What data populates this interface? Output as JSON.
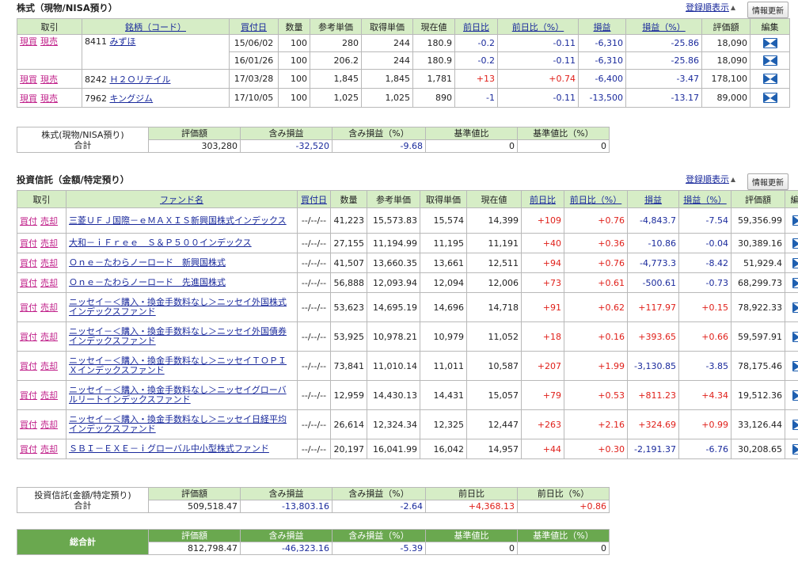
{
  "stocks": {
    "title": "株式（現物/NISA預り）",
    "sort_link": "登録順表示",
    "update_button": "情報更新",
    "headers": [
      "取引",
      "銘柄（コード）",
      "買付日",
      "数量",
      "参考単価",
      "取得単価",
      "現在値",
      "前日比",
      "前日比（%）",
      "損益",
      "損益（%）",
      "評価額",
      "編集"
    ],
    "buy_label": "現買",
    "sell_label": "現売",
    "rows": [
      {
        "code": "8411",
        "name": "みずほ",
        "date": "15/06/02",
        "qty": "100",
        "ref": "280",
        "cost": "244",
        "price": "180.9",
        "chg": "-0.2",
        "chgp": "-0.11",
        "pl": "-6,310",
        "plp": "-25.86",
        "val": "18,090"
      },
      {
        "date": "16/01/26",
        "qty": "100",
        "ref": "206.2",
        "cost": "244",
        "price": "180.9",
        "chg": "-0.2",
        "chgp": "-0.11",
        "pl": "-6,310",
        "plp": "-25.86",
        "val": "18,090"
      },
      {
        "code": "8242",
        "name": "Ｈ２Ｏリテイル",
        "date": "17/03/28",
        "qty": "100",
        "ref": "1,845",
        "cost": "1,845",
        "price": "1,781",
        "chg": "+13",
        "chgp": "+0.74",
        "pl": "-6,400",
        "plp": "-3.47",
        "val": "178,100"
      },
      {
        "code": "7962",
        "name": "キングジム",
        "date": "17/10/05",
        "qty": "100",
        "ref": "1,025",
        "cost": "1,025",
        "price": "890",
        "chg": "-1",
        "chgp": "-0.11",
        "pl": "-13,500",
        "plp": "-13.17",
        "val": "89,000"
      }
    ],
    "summary": {
      "label1": "株式(現物/NISA預り)",
      "label2": "合計",
      "headers": [
        "評価額",
        "含み損益",
        "含み損益（%）",
        "基準値比",
        "基準値比（%）"
      ],
      "values": [
        "303,280",
        "-32,520",
        "-9.68",
        "0",
        "0"
      ]
    }
  },
  "funds": {
    "title": "投資信託（金額/特定預り）",
    "sort_link": "登録順表示",
    "update_button": "情報更新",
    "headers": [
      "取引",
      "ファンド名",
      "買付日",
      "数量",
      "参考単価",
      "取得単価",
      "現在値",
      "前日比",
      "前日比（%）",
      "損益",
      "損益（%）",
      "評価額",
      "編集"
    ],
    "buy_label": "買付",
    "sell_label": "売却",
    "rows": [
      {
        "name": "三菱ＵＦＪ国際－ｅＭＡＸＩＳ新興国株式インデックス",
        "date": "--/--/--",
        "qty": "41,223",
        "ref": "15,573.83",
        "cost": "15,574",
        "price": "14,399",
        "chg": "+109",
        "chgp": "+0.76",
        "pl": "-4,843.7",
        "plp": "-7.54",
        "val": "59,356.99"
      },
      {
        "name": "大和－ｉＦｒｅｅ　Ｓ＆Ｐ５００インデックス",
        "date": "--/--/--",
        "qty": "27,155",
        "ref": "11,194.99",
        "cost": "11,195",
        "price": "11,191",
        "chg": "+40",
        "chgp": "+0.36",
        "pl": "-10.86",
        "plp": "-0.04",
        "val": "30,389.16"
      },
      {
        "name": "Ｏｎｅ－たわらノーロード　新興国株式",
        "date": "--/--/--",
        "qty": "41,507",
        "ref": "13,660.35",
        "cost": "13,661",
        "price": "12,511",
        "chg": "+94",
        "chgp": "+0.76",
        "pl": "-4,773.3",
        "plp": "-8.42",
        "val": "51,929.4"
      },
      {
        "name": "Ｏｎｅ－たわらノーロード　先進国株式",
        "date": "--/--/--",
        "qty": "56,888",
        "ref": "12,093.94",
        "cost": "12,094",
        "price": "12,006",
        "chg": "+73",
        "chgp": "+0.61",
        "pl": "-500.61",
        "plp": "-0.73",
        "val": "68,299.73"
      },
      {
        "name": "ニッセイ－＜購入・換金手数料なし＞ニッセイ外国株式インデックスファンド",
        "date": "--/--/--",
        "qty": "53,623",
        "ref": "14,695.19",
        "cost": "14,696",
        "price": "14,718",
        "chg": "+91",
        "chgp": "+0.62",
        "pl": "+117.97",
        "plp": "+0.15",
        "val": "78,922.33"
      },
      {
        "name": "ニッセイ－＜購入・換金手数料なし＞ニッセイ外国債券インデックスファンド",
        "date": "--/--/--",
        "qty": "53,925",
        "ref": "10,978.21",
        "cost": "10,979",
        "price": "11,052",
        "chg": "+18",
        "chgp": "+0.16",
        "pl": "+393.65",
        "plp": "+0.66",
        "val": "59,597.91"
      },
      {
        "name": "ニッセイ－＜購入・換金手数料なし＞ニッセイＴＯＰＩＸインデックスファンド",
        "date": "--/--/--",
        "qty": "73,841",
        "ref": "11,010.14",
        "cost": "11,011",
        "price": "10,587",
        "chg": "+207",
        "chgp": "+1.99",
        "pl": "-3,130.85",
        "plp": "-3.85",
        "val": "78,175.46"
      },
      {
        "name": "ニッセイ－＜購入・換金手数料なし＞ニッセイグローバルリートインデックスファンド",
        "date": "--/--/--",
        "qty": "12,959",
        "ref": "14,430.13",
        "cost": "14,431",
        "price": "15,057",
        "chg": "+79",
        "chgp": "+0.53",
        "pl": "+811.23",
        "plp": "+4.34",
        "val": "19,512.36"
      },
      {
        "name": "ニッセイ－＜購入・換金手数料なし＞ニッセイ日経平均インデックスファンド",
        "date": "--/--/--",
        "qty": "26,614",
        "ref": "12,324.34",
        "cost": "12,325",
        "price": "12,447",
        "chg": "+263",
        "chgp": "+2.16",
        "pl": "+324.69",
        "plp": "+0.99",
        "val": "33,126.44"
      },
      {
        "name": "ＳＢＩ－ＥＸＥ－ｉグローバル中小型株式ファンド",
        "date": "--/--/--",
        "qty": "20,197",
        "ref": "16,041.99",
        "cost": "16,042",
        "price": "14,957",
        "chg": "+44",
        "chgp": "+0.30",
        "pl": "-2,191.37",
        "plp": "-6.76",
        "val": "30,208.65"
      }
    ],
    "summary": {
      "label1": "投資信託(金額/特定預り)",
      "label2": "合計",
      "headers": [
        "評価額",
        "含み損益",
        "含み損益（%）",
        "前日比",
        "前日比（%）"
      ],
      "values": [
        "509,518.47",
        "-13,803.16",
        "-2.64",
        "+4,368.13",
        "+0.86"
      ]
    }
  },
  "total": {
    "label": "総合計",
    "headers": [
      "評価額",
      "含み損益",
      "含み損益（%）",
      "基準値比",
      "基準値比（%）"
    ],
    "values": [
      "812,798.47",
      "-46,323.16",
      "-5.39",
      "0",
      "0"
    ]
  },
  "colors": {
    "header_bg": "#d6edc6",
    "total_bg": "#6aa84f",
    "positive": "#e0201a",
    "negative": "#1a2a9c"
  }
}
